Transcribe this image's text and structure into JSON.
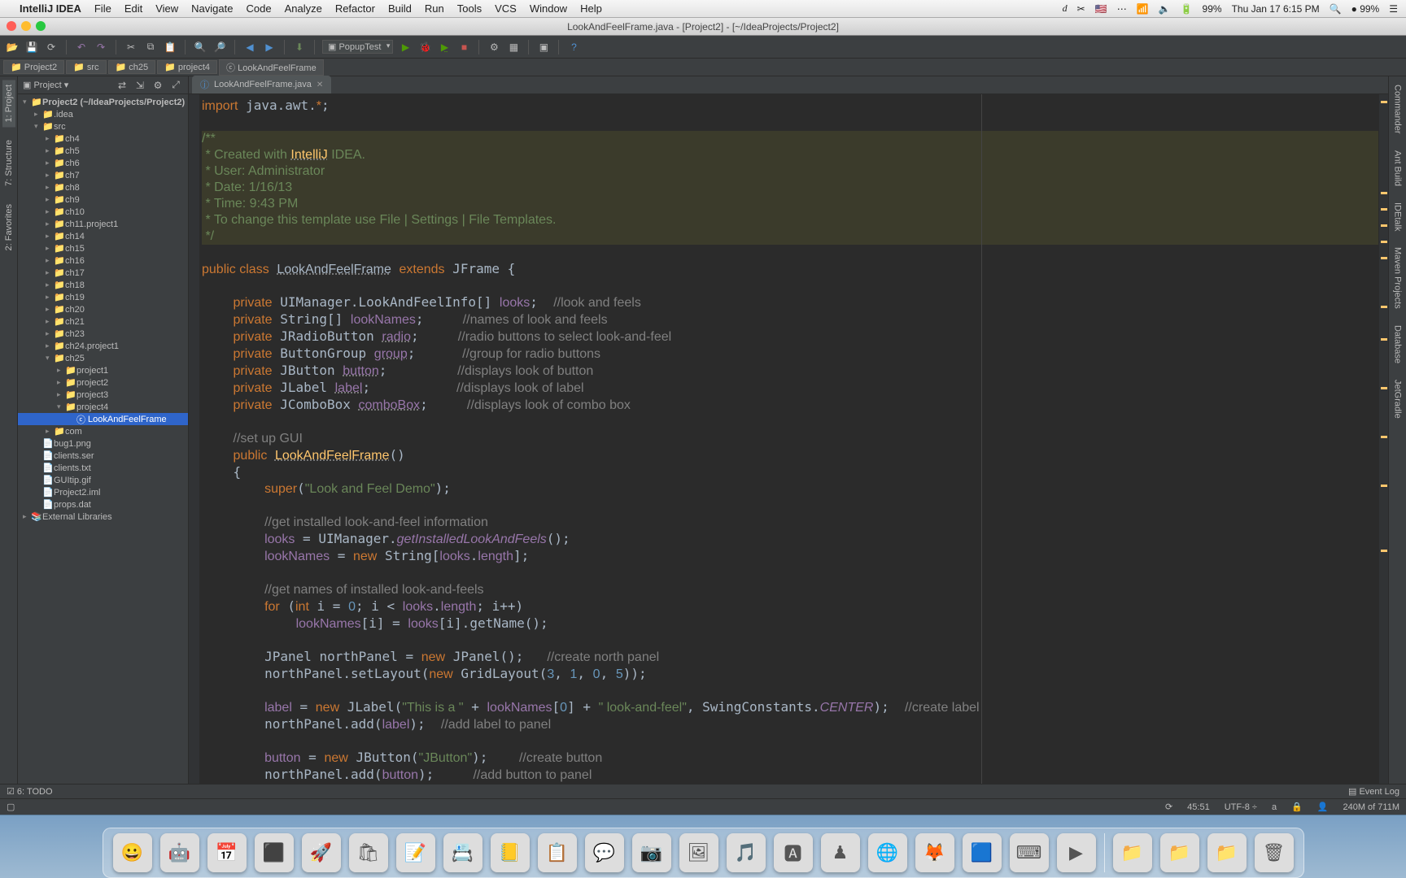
{
  "menubar": {
    "app": "IntelliJ IDEA",
    "items": [
      "File",
      "Edit",
      "View",
      "Navigate",
      "Code",
      "Analyze",
      "Refactor",
      "Build",
      "Run",
      "Tools",
      "VCS",
      "Window",
      "Help"
    ],
    "right": {
      "battery": "99%",
      "clock": "Thu Jan 17  6:15 PM",
      "batt2": "99%"
    }
  },
  "window": {
    "title": "LookAndFeelFrame.java - [Project2] - [~/IdeaProjects/Project2]"
  },
  "toolbar": {
    "run_config": "PopupTest"
  },
  "breadcrumbs": [
    "Project2",
    "src",
    "ch25",
    "project4",
    "LookAndFeelFrame"
  ],
  "project_panel": {
    "title": "Project",
    "tree": [
      {
        "d": 0,
        "c": "▾",
        "ico": "📁",
        "t": "Project2 (~/IdeaProjects/Project2)",
        "b": true
      },
      {
        "d": 1,
        "c": "▸",
        "ico": "📁",
        "t": ".idea"
      },
      {
        "d": 1,
        "c": "▾",
        "ico": "📁",
        "t": "src"
      },
      {
        "d": 2,
        "c": "▸",
        "ico": "📁",
        "t": "ch4"
      },
      {
        "d": 2,
        "c": "▸",
        "ico": "📁",
        "t": "ch5"
      },
      {
        "d": 2,
        "c": "▸",
        "ico": "📁",
        "t": "ch6"
      },
      {
        "d": 2,
        "c": "▸",
        "ico": "📁",
        "t": "ch7"
      },
      {
        "d": 2,
        "c": "▸",
        "ico": "📁",
        "t": "ch8"
      },
      {
        "d": 2,
        "c": "▸",
        "ico": "📁",
        "t": "ch9"
      },
      {
        "d": 2,
        "c": "▸",
        "ico": "📁",
        "t": "ch10"
      },
      {
        "d": 2,
        "c": "▸",
        "ico": "📁",
        "t": "ch11.project1"
      },
      {
        "d": 2,
        "c": "▸",
        "ico": "📁",
        "t": "ch14"
      },
      {
        "d": 2,
        "c": "▸",
        "ico": "📁",
        "t": "ch15"
      },
      {
        "d": 2,
        "c": "▸",
        "ico": "📁",
        "t": "ch16"
      },
      {
        "d": 2,
        "c": "▸",
        "ico": "📁",
        "t": "ch17"
      },
      {
        "d": 2,
        "c": "▸",
        "ico": "📁",
        "t": "ch18"
      },
      {
        "d": 2,
        "c": "▸",
        "ico": "📁",
        "t": "ch19"
      },
      {
        "d": 2,
        "c": "▸",
        "ico": "📁",
        "t": "ch20"
      },
      {
        "d": 2,
        "c": "▸",
        "ico": "📁",
        "t": "ch21"
      },
      {
        "d": 2,
        "c": "▸",
        "ico": "📁",
        "t": "ch23"
      },
      {
        "d": 2,
        "c": "▸",
        "ico": "📁",
        "t": "ch24.project1"
      },
      {
        "d": 2,
        "c": "▾",
        "ico": "📁",
        "t": "ch25"
      },
      {
        "d": 3,
        "c": "▸",
        "ico": "📁",
        "t": "project1"
      },
      {
        "d": 3,
        "c": "▸",
        "ico": "📁",
        "t": "project2"
      },
      {
        "d": 3,
        "c": "▸",
        "ico": "📁",
        "t": "project3"
      },
      {
        "d": 3,
        "c": "▾",
        "ico": "📁",
        "t": "project4"
      },
      {
        "d": 4,
        "c": " ",
        "ico": "ⓒ",
        "t": "LookAndFeelFrame",
        "sel": true
      },
      {
        "d": 2,
        "c": "▸",
        "ico": "📁",
        "t": "com"
      },
      {
        "d": 1,
        "c": " ",
        "ico": "📄",
        "t": "bug1.png"
      },
      {
        "d": 1,
        "c": " ",
        "ico": "📄",
        "t": "clients.ser"
      },
      {
        "d": 1,
        "c": " ",
        "ico": "📄",
        "t": "clients.txt"
      },
      {
        "d": 1,
        "c": " ",
        "ico": "📄",
        "t": "GUItip.gif"
      },
      {
        "d": 1,
        "c": " ",
        "ico": "📄",
        "t": "Project2.iml"
      },
      {
        "d": 1,
        "c": " ",
        "ico": "📄",
        "t": "props.dat"
      },
      {
        "d": 0,
        "c": "▸",
        "ico": "📚",
        "t": "External Libraries"
      }
    ]
  },
  "editor": {
    "tab_label": "LookAndFeelFrame.java",
    "code_html": "<span class='k-o'>import</span> java.awt.<span class='k-o'>*</span>;\n\n<span class='docblock'><span class='k-g'>/**</span>\n<span class='k-g'> * Created with </span><span class='k-y underline'>IntelliJ</span><span class='k-g'> IDEA.</span>\n<span class='k-g'> * User: Administrator</span>\n<span class='k-g'> * Date: 1/16/13</span>\n<span class='k-g'> * Time: 9:43 PM</span>\n<span class='k-g'> * To change this template use File | Settings | File Templates.</span>\n<span class='k-g'> */</span></span>\n<span class='k-o'>public class</span> <span class='underline'>LookAndFeelFrame</span> <span class='k-o'>extends</span> JFrame {\n\n    <span class='k-o'>private</span> UIManager.LookAndFeelInfo[] <span class='k-p'>looks</span>;  <span class='k-c'>//look and feels</span>\n    <span class='k-o'>private</span> String[] <span class='k-p'>lookNames</span>;     <span class='k-c'>//names of look and feels</span>\n    <span class='k-o'>private</span> JRadioButton <span class='k-p underline'>radio</span>;     <span class='k-c'>//radio buttons to select look-and-feel</span>\n    <span class='k-o'>private</span> ButtonGroup <span class='k-p underline'>group</span>;      <span class='k-c'>//group for radio buttons</span>\n    <span class='k-o'>private</span> JButton <span class='k-p underline'>button</span>;         <span class='k-c'>//displays look of button</span>\n    <span class='k-o'>private</span> JLabel <span class='k-p underline'>label</span>;           <span class='k-c'>//displays look of label</span>\n    <span class='k-o'>private</span> JComboBox <span class='k-p underline'>comboBox</span>;     <span class='k-c'>//displays look of combo box</span>\n\n    <span class='k-c'>//set up GUI</span>\n    <span class='k-o'>public</span> <span class='k-y underline'>LookAndFeelFrame</span>()\n    {\n        <span class='k-o'>super</span>(<span class='k-g'>\"Look and Feel Demo\"</span>);\n\n        <span class='k-c'>//get installed look-and-feel information</span>\n        <span class='k-p'>looks</span> = UIManager.<span class='it'>getInstalledLookAndFeels</span>();\n        <span class='k-p'>lookNames</span> = <span class='k-o'>new</span> String[<span class='k-p'>looks</span>.<span class='k-p'>length</span>];\n\n        <span class='k-c'>//get names of installed look-and-feels</span>\n        <span class='k-o'>for</span> (<span class='k-o'>int</span> i = <span class='num'>0</span>; i &lt; <span class='k-p'>looks</span>.<span class='k-p'>length</span>; i++)\n            <span class='k-p'>lookNames</span>[i] = <span class='k-p'>looks</span>[i].getName();\n\n        JPanel northPanel = <span class='k-o'>new</span> JPanel();   <span class='k-c'>//create north panel</span>\n        northPanel.setLayout(<span class='k-o'>new</span> GridLayout(<span class='num'>3</span>, <span class='num'>1</span>, <span class='num'>0</span>, <span class='num'>5</span>));\n\n        <span class='k-p'>label</span> = <span class='k-o'>new</span> JLabel(<span class='k-g'>\"This is a \"</span> + <span class='k-p'>lookNames</span>[<span class='num'>0</span>] + <span class='k-g'>\" look-and-feel\"</span>, SwingConstants.<span class='k-p it'>CENTER</span>);  <span class='k-c'>//create label</span>\n        northPanel.add(<span class='k-p'>label</span>);  <span class='k-c'>//add label to panel</span>\n\n        <span class='k-p'>button</span> = <span class='k-o'>new</span> JButton(<span class='k-g'>\"JButton\"</span>);    <span class='k-c'>//create button</span>\n        northPanel.add(<span class='k-p'>button</span>);     <span class='k-c'>//add button to panel</span>\n\n        <span class='k-p'>comboBox</span> = <span class='k-o'>new</span> JComboBox(<span class='k-p'>lookNames</span>);    <span class='k-c'>//</span>\n    }"
  },
  "left_tabs": [
    "1: Project",
    "7: Structure",
    "2: Favorites"
  ],
  "right_tabs": [
    "Commander",
    "Ant Build",
    "IDEtalk",
    "Maven Projects",
    "Database",
    "JetGradle"
  ],
  "bottom": {
    "todo": "6: TODO",
    "eventlog": "Event Log"
  },
  "status": {
    "pos": "45:51",
    "enc": "UTF-8",
    "mem": "240M of 711M"
  },
  "dock_icons": [
    "finder-icon",
    "automator-icon",
    "calendar-icon",
    "terminal-icon",
    "launchpad-icon",
    "appstore-icon",
    "textedit-icon",
    "contacts-icon",
    "notes-icon",
    "stickies-icon",
    "messages-icon",
    "photobooth-icon",
    "photos-icon",
    "itunes-icon",
    "appstore2-icon",
    "chess-icon",
    "chrome-icon",
    "firefox-icon",
    "intellij-icon",
    "bash-icon",
    "quicktime-icon"
  ],
  "dock_right": [
    "folder1-icon",
    "folder2-icon",
    "downloads-icon",
    "trash-icon"
  ]
}
